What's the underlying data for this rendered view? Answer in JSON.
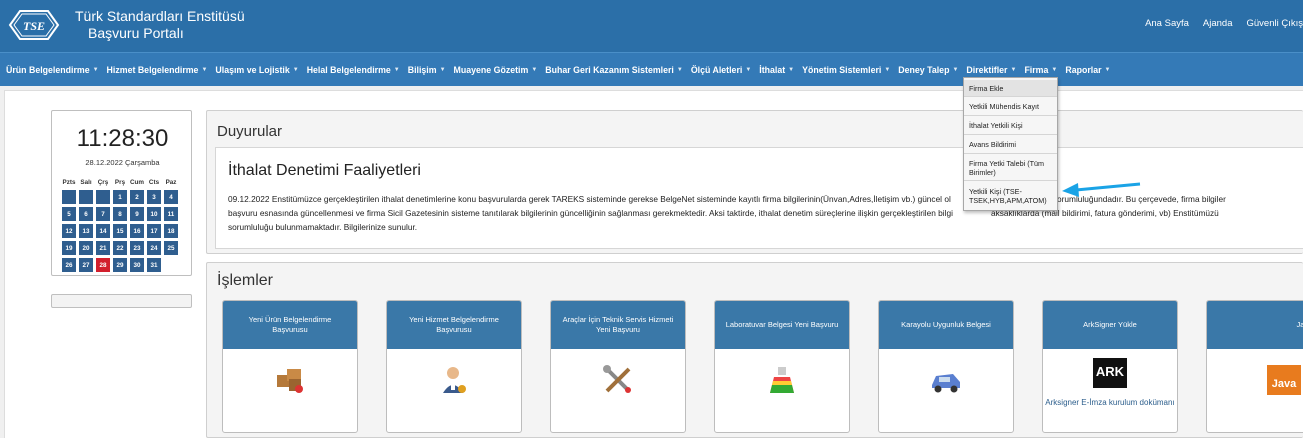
{
  "header": {
    "brand_line1": "Türk Standardları Enstitüsü",
    "brand_line2": "Başvuru Portalı",
    "links": [
      "Ana Sayfa",
      "Ajanda",
      "Güvenli Çıkış"
    ]
  },
  "nav": {
    "items": [
      "Ürün Belgelendirme",
      "Hizmet Belgelendirme",
      "Ulaşım ve Lojistik",
      "Helal Belgelendirme",
      "Bilişim",
      "Muayene Gözetim",
      "Buhar Geri Kazanım Sistemleri",
      "Ölçü Aletleri",
      "İthalat",
      "Yönetim Sistemleri",
      "Deney Talep",
      "Direktifler",
      "Firma",
      "Raporlar"
    ]
  },
  "dropdown": {
    "items": [
      "Firma Ekle",
      "Yetkili Mühendis Kayıt",
      "İthalat Yetkili Kişi",
      "Avans Bildirimi",
      "Firma Yetki Talebi (Tüm Birimler)",
      "Yetkili Kişi (TSE-TSEK,HYB,APM,ATOM)"
    ]
  },
  "clock": {
    "time": "11:28:30",
    "date": "28.12.2022 Çarşamba",
    "weekdays": [
      "Pzts",
      "Salı",
      "Çrş",
      "Prş",
      "Cum",
      "Cts",
      "Paz"
    ],
    "days": [
      "",
      "",
      "",
      "1",
      "2",
      "3",
      "4",
      "5",
      "6",
      "7",
      "8",
      "9",
      "10",
      "11",
      "12",
      "13",
      "14",
      "15",
      "16",
      "17",
      "18",
      "19",
      "20",
      "21",
      "22",
      "23",
      "24",
      "25",
      "26",
      "27",
      "28",
      "29",
      "30",
      "31"
    ],
    "today": "28"
  },
  "announcements": {
    "title": "Duyurular",
    "subtitle": "İthalat Denetimi Faaliyetleri",
    "lines": [
      "09.12.2022 Enstitümüzce gerçekleştirilen ithalat denetimlerine konu başvurularda gerek TAREKS sisteminde gerekse BelgeNet sisteminde kayıtlı firma bilgilerinin(Ünvan,Adres,İletişim vb.) güncel ol",
      "başvuru esnasında güncellenmesi ve firma Sicil Gazetesinin sisteme tanıtılarak bilgilerinin güncelliğinin sağlanması gerekmektedir. Aksi taktirde, ithalat denetim süreçlerine ilişkin gerçekleştirilen bilgi",
      "sorumluluğu bulunmamaktadır. Bilgilerinize sunulur."
    ],
    "line1_tail": "akibi firma sorumluluğundadır. Bu çerçevede, firma bilgiler",
    "line2_tail": "aksaklıklarda (mail bildirimi, fatura gönderimi, vb) Enstitümüzü"
  },
  "operations": {
    "title": "İşlemler",
    "tiles": [
      {
        "label": "Yeni Ürün Belgelendirme Başvurusu",
        "caption": ""
      },
      {
        "label": "Yeni Hizmet Belgelendirme Başvurusu",
        "caption": ""
      },
      {
        "label": "Araçlar İçin Teknik Servis Hizmeti Yeni Başvuru",
        "caption": ""
      },
      {
        "label": "Laboratuvar Belgesi Yeni Başvuru",
        "caption": ""
      },
      {
        "label": "Karayolu Uygunluk Belgesi",
        "caption": ""
      },
      {
        "label": "ArkSigner Yükle",
        "caption": "Arksigner E-İmza kurulum dokümanı"
      },
      {
        "label": "Java Yükle",
        "caption": ""
      }
    ]
  },
  "colors": {
    "header": "#2b6fa8",
    "nav": "#347ab7",
    "tile_head": "#3a78a8",
    "today": "#d21f2d",
    "arrow": "#1aa3e6"
  }
}
